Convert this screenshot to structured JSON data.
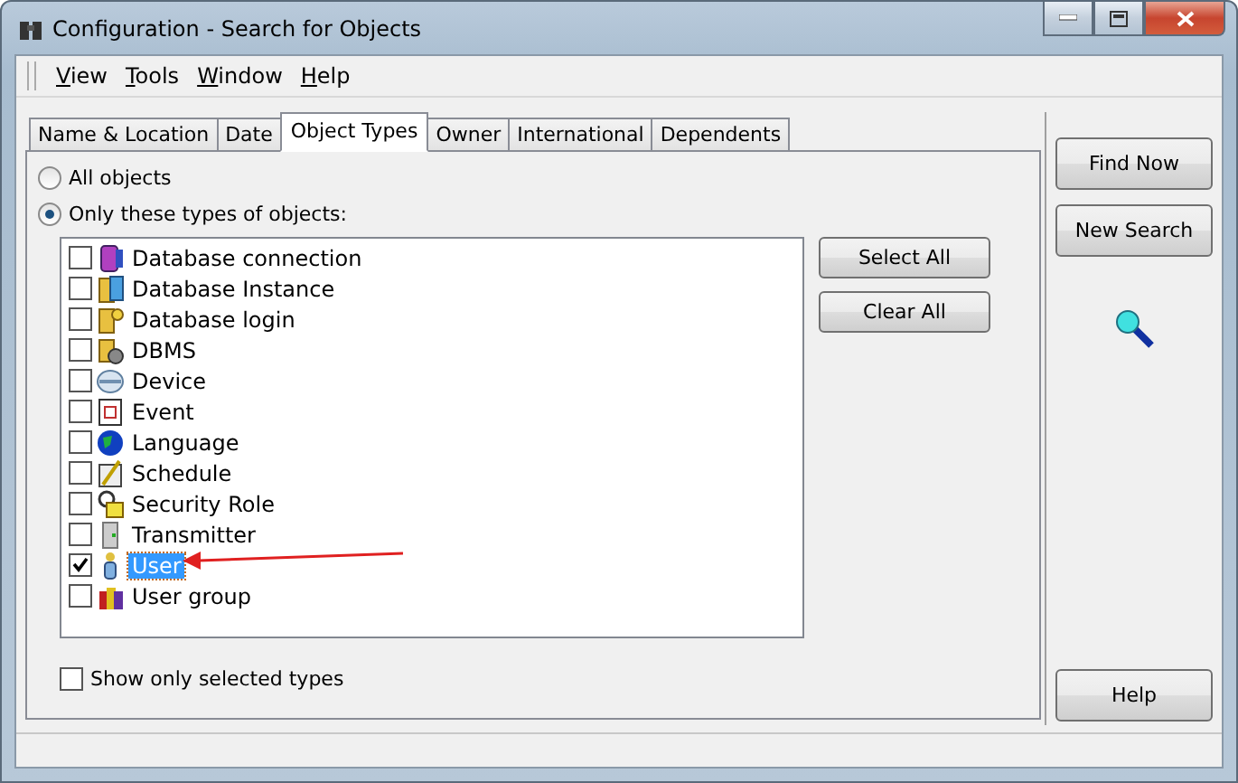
{
  "window": {
    "title": "Configuration - Search for Objects"
  },
  "menu": [
    "View",
    "Tools",
    "Window",
    "Help"
  ],
  "tabs": [
    {
      "label": "Name & Location",
      "selected": false
    },
    {
      "label": "Date",
      "selected": false
    },
    {
      "label": "Object Types",
      "selected": true
    },
    {
      "label": "Owner",
      "selected": false
    },
    {
      "label": "International",
      "selected": false
    },
    {
      "label": "Dependents",
      "selected": false
    }
  ],
  "scope": [
    {
      "label": "All objects",
      "selected": false
    },
    {
      "label": "Only these types of objects:",
      "selected": true
    }
  ],
  "object_types": [
    {
      "label": "Database connection",
      "checked": false,
      "selected": false
    },
    {
      "label": "Database Instance",
      "checked": false,
      "selected": false
    },
    {
      "label": "Database login",
      "checked": false,
      "selected": false
    },
    {
      "label": "DBMS",
      "checked": false,
      "selected": false
    },
    {
      "label": "Device",
      "checked": false,
      "selected": false
    },
    {
      "label": "Event",
      "checked": false,
      "selected": false
    },
    {
      "label": "Language",
      "checked": false,
      "selected": false
    },
    {
      "label": "Schedule",
      "checked": false,
      "selected": false
    },
    {
      "label": "Security Role",
      "checked": false,
      "selected": false
    },
    {
      "label": "Transmitter",
      "checked": false,
      "selected": false
    },
    {
      "label": "User",
      "checked": true,
      "selected": true
    },
    {
      "label": "User group",
      "checked": false,
      "selected": false
    }
  ],
  "list_buttons": [
    "Select All",
    "Clear All"
  ],
  "show_only_selected": {
    "label": "Show only selected types",
    "checked": false
  },
  "side_buttons": [
    "Find Now",
    "New Search"
  ],
  "help_button": "Help"
}
